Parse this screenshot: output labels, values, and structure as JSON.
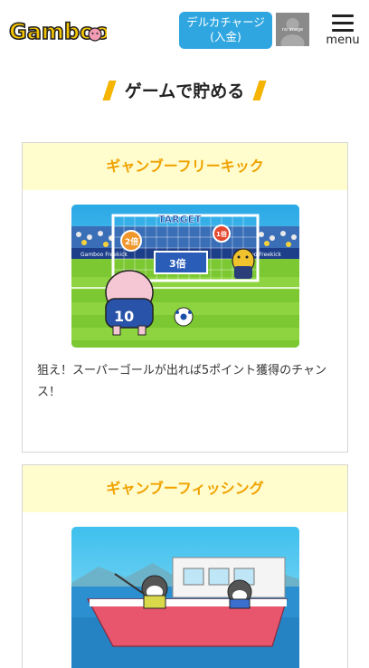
{
  "header": {
    "logo_text": "Gamboo",
    "deposit_button": {
      "line1": "デルカチャージ",
      "line2": "(入金)"
    },
    "avatar_label": "no image",
    "menu_label": "menu"
  },
  "section": {
    "title": "ゲームで貯める"
  },
  "games": [
    {
      "title": "ギャンブーフリーキック",
      "description": "狙え！スーパーゴールが出れば5ポイント獲得のチャンス！",
      "image_text": {
        "target": "TARGET",
        "badge_left": "2倍",
        "badge_right": "1倍",
        "center": "3倍",
        "jersey": "10",
        "banner": "Gamboo Freekick"
      }
    },
    {
      "title": "ギャンブーフィッシング"
    }
  ],
  "colors": {
    "accent": "#f5b400",
    "card_title": "#f0a200",
    "card_head_bg": "#fffccd",
    "button": "#2fa6e0"
  }
}
